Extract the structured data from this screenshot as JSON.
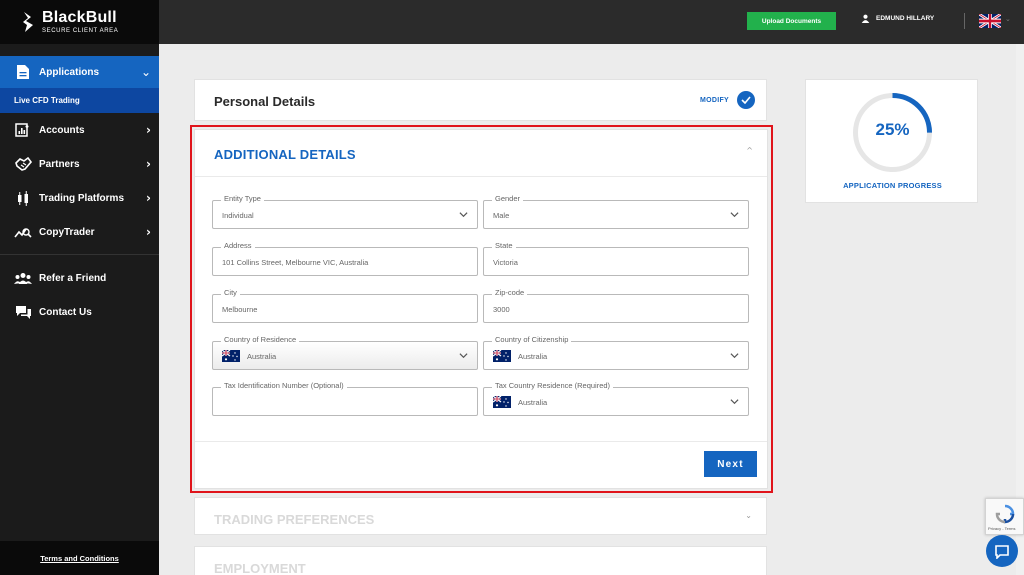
{
  "brand": {
    "name": "BlackBull",
    "tagline": "SECURE CLIENT AREA"
  },
  "sidebar": {
    "active": {
      "label": "Applications",
      "icon": "document-icon"
    },
    "active_sub": {
      "label": "Live CFD Trading"
    },
    "items": [
      {
        "label": "Accounts",
        "icon": "accounts-chart-icon",
        "has_submenu": true
      },
      {
        "label": "Partners",
        "icon": "handshake-icon",
        "has_submenu": true
      },
      {
        "label": "Trading Platforms",
        "icon": "candlestick-icon",
        "has_submenu": true
      },
      {
        "label": "CopyTrader",
        "icon": "copytrader-icon",
        "has_submenu": true
      },
      {
        "label": "Refer a Friend",
        "icon": "users-icon",
        "has_submenu": false
      },
      {
        "label": "Contact Us",
        "icon": "chat-bubbles-icon",
        "has_submenu": false
      }
    ],
    "footer_link": "Terms and Conditions"
  },
  "topbar": {
    "upload_label": "Upload Documents",
    "user_name": "EDMUND HILLARY",
    "language_flag": "uk-flag-icon"
  },
  "personal": {
    "title": "Personal Details",
    "modify_label": "MODIFY"
  },
  "additional": {
    "title": "ADDITIONAL DETAILS",
    "fields": {
      "entity_type": {
        "label": "Entity Type",
        "value": "Individual"
      },
      "gender": {
        "label": "Gender",
        "value": "Male"
      },
      "address": {
        "label": "Address",
        "value": "101 Collins Street, Melbourne VIC, Australia"
      },
      "state": {
        "label": "State",
        "value": "Victoria"
      },
      "city": {
        "label": "City",
        "value": "Melbourne"
      },
      "zip": {
        "label": "Zip-code",
        "value": "3000"
      },
      "country_residence": {
        "label": "Country of Residence",
        "value": "Australia"
      },
      "country_citizenship": {
        "label": "Country of Citizenship",
        "value": "Australia"
      },
      "tin": {
        "label": "Tax Identification Number (Optional)",
        "value": ""
      },
      "tax_country": {
        "label": "Tax Country Residence (Required)",
        "value": "Australia"
      }
    },
    "next_label": "Next"
  },
  "sections": {
    "trading": "TRADING PREFERENCES",
    "employment": "EMPLOYMENT"
  },
  "progress": {
    "percent_text": "25%",
    "value": 0.25,
    "label": "APPLICATION PROGRESS"
  },
  "recaptcha": {
    "text": "Privacy - Terms"
  },
  "colors": {
    "primary": "#1565c0",
    "sidebar": "#1b1b1b",
    "upload": "#22b14c",
    "highlight": "#e0141b"
  }
}
